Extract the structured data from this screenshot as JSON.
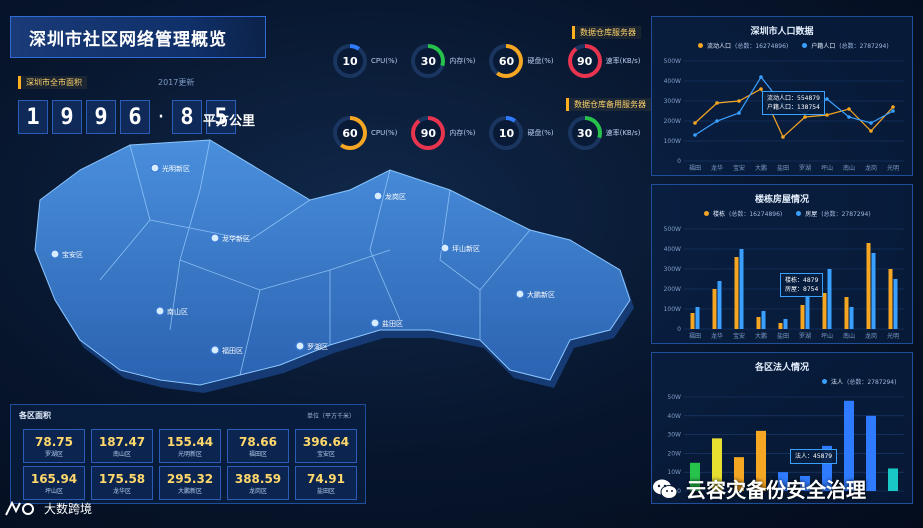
{
  "header": {
    "title": "深圳市社区网络管理概览"
  },
  "area_total": {
    "tag": "深圳市全市面积",
    "year_note": "2017更新",
    "digits": [
      "1",
      "9",
      "9",
      "6",
      "·",
      "8",
      "5"
    ],
    "unit": "平方公里"
  },
  "servers": {
    "primary_title": "数据仓库服务器",
    "backup_title": "数据仓库备用服务器",
    "primary": [
      {
        "value": "10",
        "label": "CPU(%)",
        "color": "#2f7bff"
      },
      {
        "value": "30",
        "label": "内存(%)",
        "color": "#27c24c"
      },
      {
        "value": "60",
        "label": "硬盘(%)",
        "color": "#f5a623"
      },
      {
        "value": "90",
        "label": "速率(KB/s)",
        "color": "#e8344e"
      }
    ],
    "backup": [
      {
        "value": "60",
        "label": "CPU(%)",
        "color": "#f5a623"
      },
      {
        "value": "90",
        "label": "内存(%)",
        "color": "#e8344e"
      },
      {
        "value": "10",
        "label": "硬盘(%)",
        "color": "#2f7bff"
      },
      {
        "value": "30",
        "label": "速率(KB/s)",
        "color": "#27c24c"
      }
    ]
  },
  "map": {
    "districts": [
      "光明新区",
      "宝安区",
      "龙华新区",
      "南山区",
      "福田区",
      "罗湖区",
      "盐田区",
      "龙岗区",
      "坪山新区",
      "大鹏新区"
    ]
  },
  "district_area": {
    "title": "各区面积",
    "unit": "单位（平方千米）",
    "rows": [
      [
        {
          "v": "78.75",
          "n": "罗湖区"
        },
        {
          "v": "187.47",
          "n": "南山区"
        },
        {
          "v": "155.44",
          "n": "光明新区"
        },
        {
          "v": "78.66",
          "n": "福田区"
        },
        {
          "v": "396.64",
          "n": "宝安区"
        }
      ],
      [
        {
          "v": "165.94",
          "n": "坪山区"
        },
        {
          "v": "175.58",
          "n": "龙华区"
        },
        {
          "v": "295.32",
          "n": "大鹏新区"
        },
        {
          "v": "388.59",
          "n": "龙岗区"
        },
        {
          "v": "74.91",
          "n": "盐田区"
        }
      ]
    ]
  },
  "population_panel": {
    "title": "深圳市人口数据",
    "legend": [
      {
        "name": "流动人口",
        "note": "(总数：16274896)",
        "color": "#f5a623"
      },
      {
        "name": "户籍人口",
        "note": "(总数：2787294)",
        "color": "#3aa0ff"
      }
    ],
    "tooltip": [
      "流动人口：554879",
      "户籍人口：138754"
    ]
  },
  "housing_panel": {
    "title": "楼栋房屋情况",
    "legend": [
      {
        "name": "楼栋",
        "note": "(总数：16274896)",
        "color": "#f5a623"
      },
      {
        "name": "房屋",
        "note": "(总数：2787294)",
        "color": "#3aa0ff"
      }
    ],
    "tooltip": [
      "楼栋：4879",
      "房屋：8754"
    ]
  },
  "legal_panel": {
    "title": "各区法人情况",
    "legend": [
      {
        "name": "法人",
        "note": "(总数：2787294)",
        "color": "#3aa0ff"
      }
    ],
    "tooltip": [
      "法人：45879"
    ]
  },
  "chart_data": [
    {
      "type": "line",
      "categories": [
        "福田",
        "龙华",
        "宝安",
        "大鹏",
        "盐田",
        "罗湖",
        "坪山",
        "南山",
        "龙岗",
        "光明"
      ],
      "yticks": [
        "0",
        "100W",
        "200W",
        "300W",
        "400W",
        "500W"
      ],
      "ylim": [
        0,
        500
      ],
      "series": [
        {
          "name": "流动人口",
          "values": [
            190,
            290,
            300,
            360,
            120,
            220,
            230,
            260,
            150,
            270
          ]
        },
        {
          "name": "户籍人口",
          "values": [
            130,
            200,
            240,
            420,
            280,
            240,
            310,
            220,
            190,
            250
          ]
        }
      ]
    },
    {
      "type": "bar",
      "categories": [
        "福田",
        "龙华",
        "宝安",
        "大鹏",
        "盐田",
        "罗湖",
        "坪山",
        "南山",
        "龙岗",
        "光明"
      ],
      "yticks": [
        "0",
        "100W",
        "200W",
        "300W",
        "400W",
        "500W"
      ],
      "ylim": [
        0,
        500
      ],
      "series": [
        {
          "name": "楼栋",
          "values": [
            80,
            200,
            360,
            60,
            30,
            120,
            180,
            160,
            430,
            300
          ]
        },
        {
          "name": "房屋",
          "values": [
            110,
            240,
            400,
            90,
            50,
            170,
            300,
            110,
            380,
            250
          ]
        }
      ]
    },
    {
      "type": "bar",
      "categories": [
        "",
        "",
        "",
        "",
        "",
        "",
        "",
        "",
        "",
        ""
      ],
      "yticks": [
        "0",
        "10W",
        "20W",
        "30W",
        "40W",
        "50W"
      ],
      "ylim": [
        0,
        50
      ],
      "series": [
        {
          "name": "法人",
          "values": [
            15,
            28,
            18,
            32,
            10,
            8,
            24,
            48,
            40,
            12
          ]
        }
      ],
      "colors": [
        "#27c24c",
        "#e8e030",
        "#f5a623",
        "#f5a623",
        "#2f7bff",
        "#2f7bff",
        "#2f7bff",
        "#2f7bff",
        "#2f7bff",
        "#19c7c7"
      ]
    }
  ],
  "watermarks": {
    "right": "云容灾备份安全治理",
    "left": "大数跨境"
  }
}
